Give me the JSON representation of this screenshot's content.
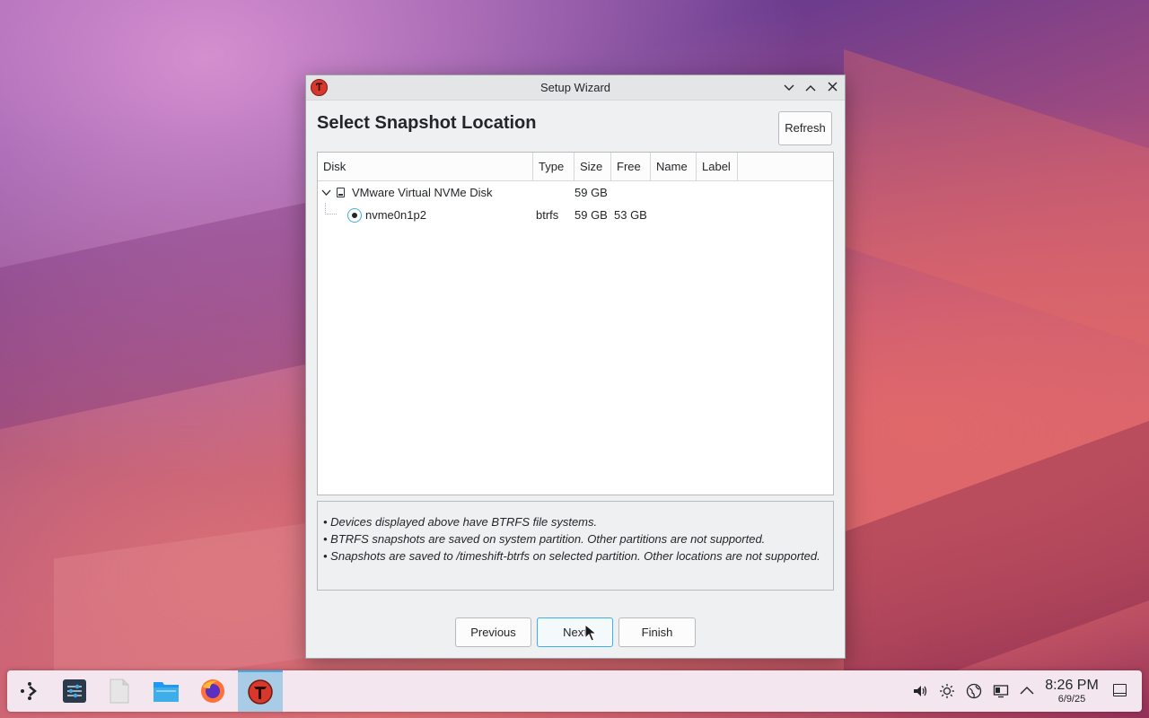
{
  "window": {
    "title": "Setup Wizard",
    "app_icon_glyph": "Ƭ",
    "minimize_glyph": "⌄",
    "maximize_glyph": "⌃",
    "close_glyph": "✕"
  },
  "page": {
    "heading": "Select Snapshot Location",
    "refresh_label": "Refresh"
  },
  "table": {
    "columns": [
      "Disk",
      "Type",
      "Size",
      "Free",
      "Name",
      "Label"
    ],
    "rows": [
      {
        "disk": "VMware Virtual NVMe Disk",
        "type": "",
        "size": "59 GB",
        "free": "",
        "name": "",
        "label": "",
        "expanded": true,
        "icon": "disk-icon"
      },
      {
        "disk": "nvme0n1p2",
        "type": "btrfs",
        "size": "59 GB",
        "free": "53 GB",
        "name": "",
        "label": "",
        "selected": true,
        "icon": "radio-icon"
      }
    ]
  },
  "info": {
    "lines": [
      "• Devices displayed above have BTRFS file systems.",
      "• BTRFS snapshots are saved on system partition. Other partitions are not supported.",
      "• Snapshots are saved to /timeshift-btrfs on selected partition. Other locations are not supported."
    ]
  },
  "buttons": {
    "previous": "Previous",
    "next": "Next",
    "finish": "Finish"
  },
  "taskbar": {
    "apps": [
      {
        "name": "application-launcher-icon"
      },
      {
        "name": "system-settings-icon"
      },
      {
        "name": "text-file-icon"
      },
      {
        "name": "file-manager-icon"
      },
      {
        "name": "firefox-icon"
      },
      {
        "name": "timeshift-icon",
        "active": true
      }
    ],
    "tray": [
      "volume-icon",
      "brightness-icon",
      "network-globe-icon",
      "display-icon",
      "tray-expand-icon"
    ],
    "time": "8:26 PM",
    "date": "6/9/25"
  },
  "colors": {
    "accent": "#3daee9",
    "timeshift_red": "#d8372c"
  }
}
